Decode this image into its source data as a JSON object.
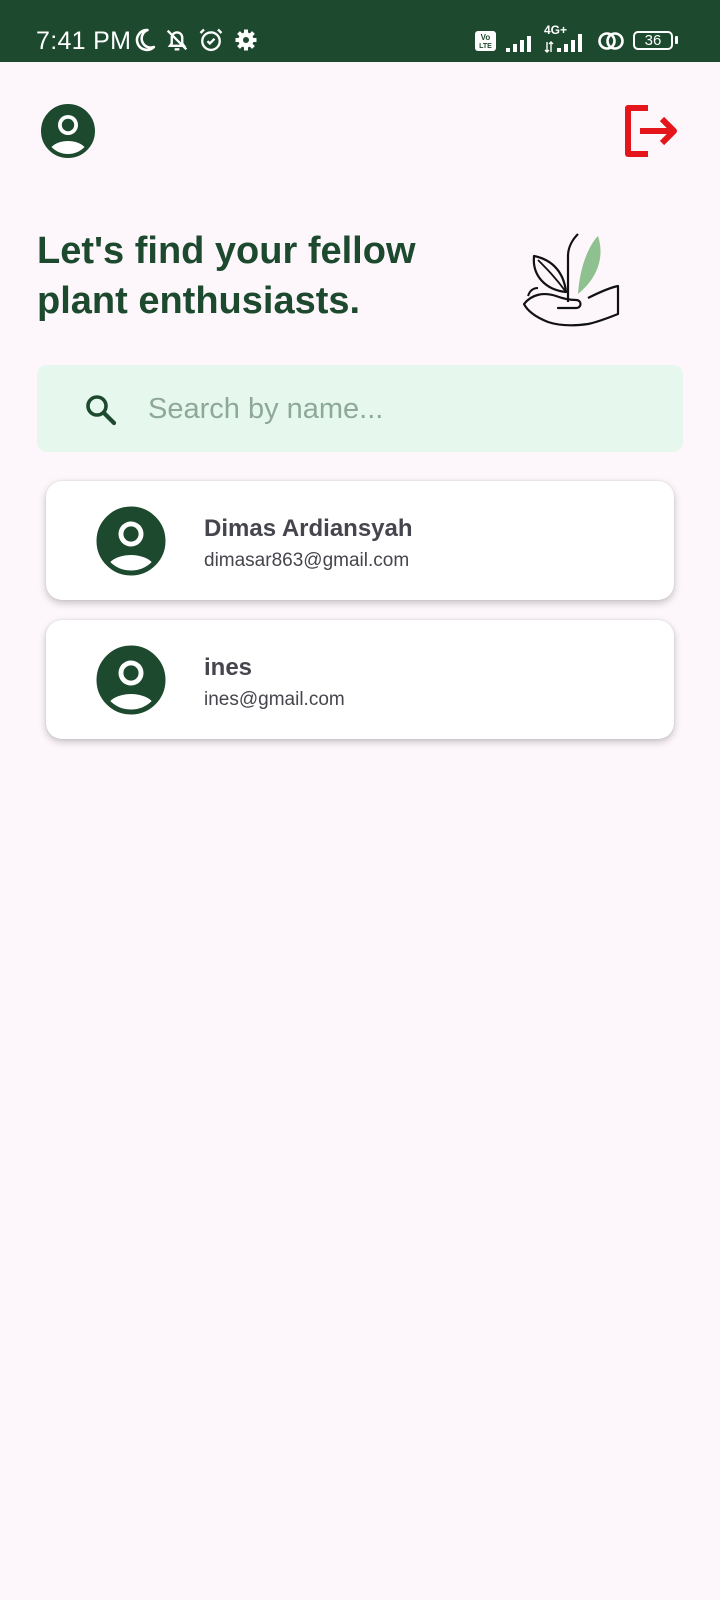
{
  "status_bar": {
    "time": "7:41 PM",
    "network_label": "4G+",
    "battery": "36",
    "icons": [
      "moon-icon",
      "bell-off-icon",
      "alarm-icon",
      "settings-icon",
      "volte-icon",
      "signal-icon",
      "signal-4g-icon",
      "hotspot-icon",
      "battery-icon"
    ]
  },
  "header": {
    "profile_icon": "account-circle-icon",
    "logout_icon": "logout-icon"
  },
  "hero": {
    "title": "Let's find your fellow plant enthusiasts.",
    "illustration": "plant-in-hand-icon"
  },
  "search": {
    "placeholder": "Search by name...",
    "value": "",
    "icon": "search-icon"
  },
  "users": [
    {
      "name": "Dimas Ardiansyah",
      "email": "dimasar863@gmail.com"
    },
    {
      "name": "ines",
      "email": "ines@gmail.com"
    }
  ],
  "colors": {
    "primary": "#1d4a2e",
    "background": "#fdf7fb",
    "search_bg": "#e6f8ee",
    "logout": "#e4151b",
    "leaf": "#8fc08f",
    "text": "#45454d"
  }
}
